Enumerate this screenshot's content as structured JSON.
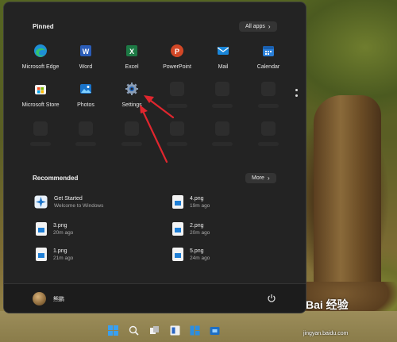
{
  "start_menu": {
    "pinned_title": "Pinned",
    "all_apps_label": "All apps",
    "pinned_apps": [
      {
        "label": "Microsoft Edge",
        "icon": "edge-icon"
      },
      {
        "label": "Word",
        "icon": "word-icon"
      },
      {
        "label": "Excel",
        "icon": "excel-icon"
      },
      {
        "label": "PowerPoint",
        "icon": "powerpoint-icon"
      },
      {
        "label": "Mail",
        "icon": "mail-icon"
      },
      {
        "label": "Calendar",
        "icon": "calendar-icon"
      },
      {
        "label": "Microsoft Store",
        "icon": "store-icon"
      },
      {
        "label": "Photos",
        "icon": "photos-icon"
      },
      {
        "label": "Settings",
        "icon": "gear-icon"
      }
    ],
    "recommended_title": "Recommended",
    "more_label": "More",
    "recommended": [
      {
        "name": "Get Started",
        "sub": "Welcome to Windows",
        "icon": "get-started-icon"
      },
      {
        "name": "4.png",
        "sub": "19m ago",
        "icon": "image-file-icon"
      },
      {
        "name": "3.png",
        "sub": "20m ago",
        "icon": "image-file-icon"
      },
      {
        "name": "2.png",
        "sub": "20m ago",
        "icon": "image-file-icon"
      },
      {
        "name": "1.png",
        "sub": "21m ago",
        "icon": "image-file-icon"
      },
      {
        "name": "5.png",
        "sub": "24m ago",
        "icon": "image-file-icon"
      }
    ],
    "user_name": "熊鹏"
  },
  "watermark": {
    "logo": "Bai 经验",
    "url": "jingyan.baidu.com"
  },
  "colors": {
    "panel": "#232323",
    "annotation_arrow": "#e0262e",
    "accent": "#0078d4"
  }
}
